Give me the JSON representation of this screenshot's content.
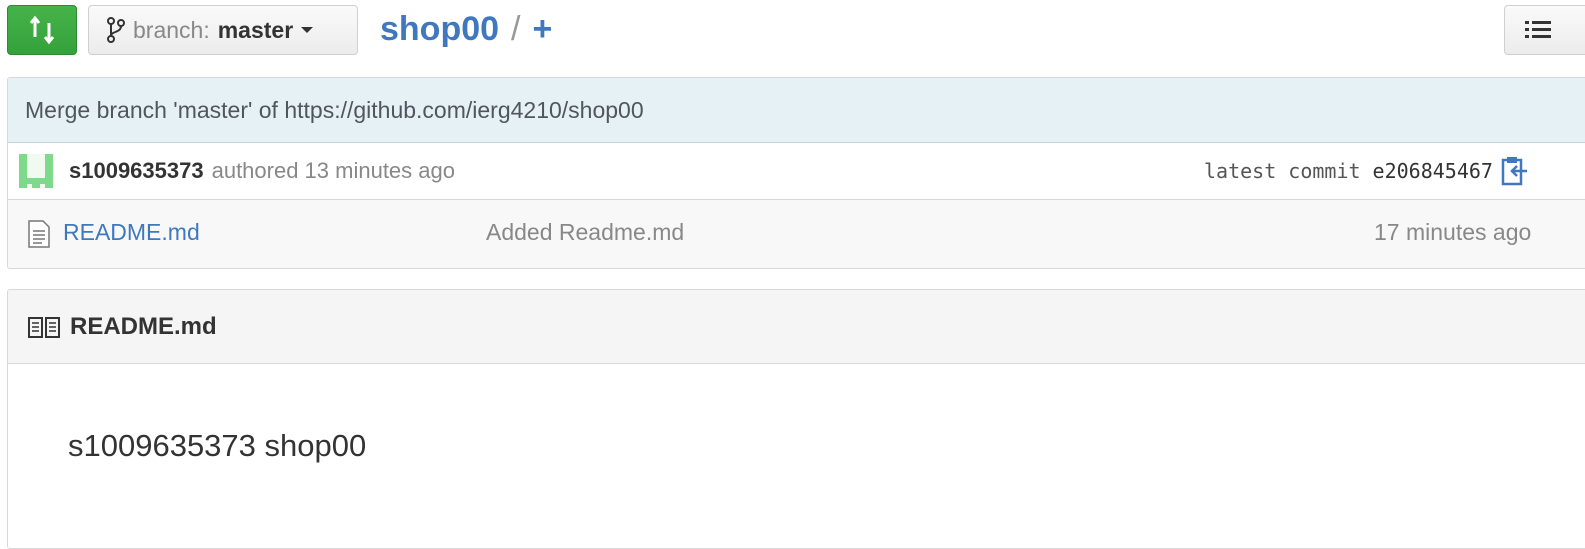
{
  "toolbar": {
    "compare_icon": "compare-arrows-icon",
    "branch": {
      "prefix": "branch:",
      "name": "master",
      "icon": "branch-icon"
    },
    "breadcrumb": {
      "repo": "shop00",
      "separator": "/",
      "add": "+"
    },
    "list_icon": "list-icon"
  },
  "commit": {
    "message": "Merge branch 'master' of https://github.com/ierg4210/shop00",
    "author": "s1009635373",
    "authored_text": "authored 13 minutes ago",
    "latest_label": "latest commit",
    "sha": "e206845467",
    "copy_icon": "clipboard-icon"
  },
  "files": [
    {
      "icon": "file-text-icon",
      "name": "README.md",
      "message": "Added Readme.md",
      "age": "17 minutes ago"
    }
  ],
  "readme": {
    "icon": "book-icon",
    "title": "README.md",
    "content": "s1009635373 shop00"
  },
  "colors": {
    "accent": "#4078c0",
    "green": "#3fae45",
    "commit_bg": "#e6f1f6"
  }
}
